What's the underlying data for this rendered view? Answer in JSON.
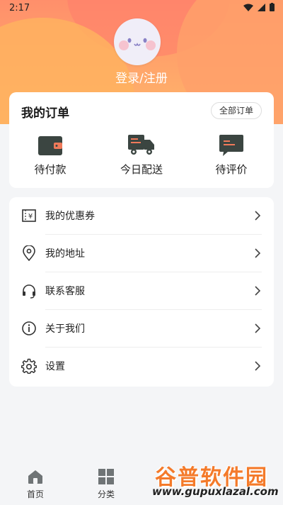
{
  "status_bar": {
    "time": "2:17"
  },
  "profile": {
    "login_label": "登录/注册"
  },
  "orders": {
    "title": "我的订单",
    "all_orders_label": "全部订单",
    "items": [
      {
        "label": "待付款",
        "icon": "wallet-icon"
      },
      {
        "label": "今日配送",
        "icon": "truck-icon"
      },
      {
        "label": "待评价",
        "icon": "comment-icon"
      }
    ]
  },
  "menu": [
    {
      "label": "我的优惠券",
      "icon": "coupon-icon"
    },
    {
      "label": "我的地址",
      "icon": "location-icon"
    },
    {
      "label": "联系客服",
      "icon": "headset-icon"
    },
    {
      "label": "关于我们",
      "icon": "info-icon"
    },
    {
      "label": "设置",
      "icon": "gear-icon"
    }
  ],
  "tabbar": [
    {
      "label": "首页",
      "icon": "home-icon"
    },
    {
      "label": "分类",
      "icon": "grid-icon"
    }
  ],
  "watermark": {
    "brand": "谷普软件园",
    "url": "www.gupuxlazal.com"
  },
  "colors": {
    "accent": "#ff8f6b",
    "icon_dark": "#3b4541",
    "icon_accent": "#f07a5a"
  }
}
